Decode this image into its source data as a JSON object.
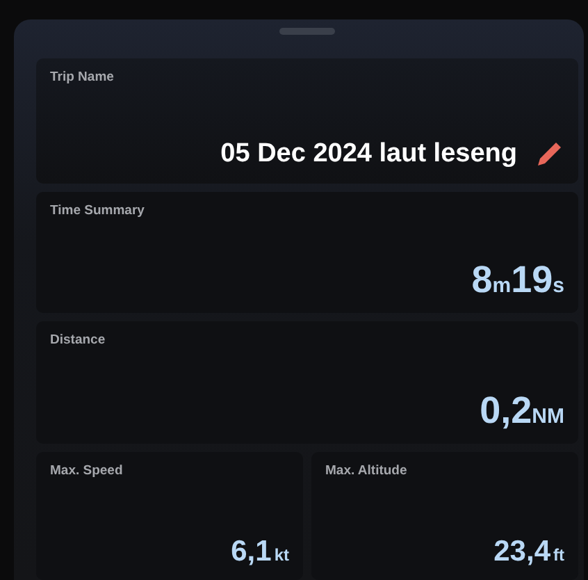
{
  "trip_name": {
    "label": "Trip Name",
    "value": "05 Dec 2024 laut leseng"
  },
  "time_summary": {
    "label": "Time Summary",
    "parts": [
      {
        "kind": "number",
        "text": "8"
      },
      {
        "kind": "unit",
        "text": "m"
      },
      {
        "kind": "number",
        "text": "19"
      },
      {
        "kind": "unit",
        "text": "s"
      }
    ]
  },
  "distance": {
    "label": "Distance",
    "parts": [
      {
        "kind": "number",
        "text": "0,2"
      },
      {
        "kind": "unit",
        "text": "NM"
      }
    ]
  },
  "stats": [
    {
      "label": "Max. Speed",
      "parts": [
        {
          "kind": "number",
          "text": "6,1"
        },
        {
          "kind": "unit",
          "text": "kt"
        }
      ]
    },
    {
      "label": "Max. Altitude",
      "parts": [
        {
          "kind": "number",
          "text": "23,4"
        },
        {
          "kind": "unit",
          "text": "ft"
        }
      ]
    }
  ]
}
